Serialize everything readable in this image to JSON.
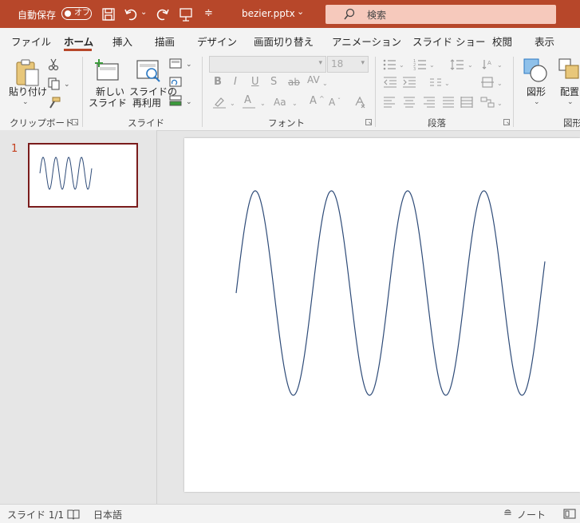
{
  "titlebar": {
    "autosave_label": "自動保存",
    "autosave_state": "オフ",
    "filename": "bezier.pptx",
    "filename_caret": "⌄",
    "search_placeholder": "検索",
    "bg_color": "#b7472a"
  },
  "tabs": [
    "ファイル",
    "ホーム",
    "挿入",
    "描画",
    "デザイン",
    "画面切り替え",
    "アニメーション",
    "スライド ショー",
    "校閲",
    "表示"
  ],
  "active_tab": "ホーム",
  "ribbon": {
    "clipboard": {
      "paste_label": "貼り付け",
      "group_label": "クリップボード"
    },
    "slides": {
      "new_slide_line1": "新しい",
      "new_slide_line2": "スライド",
      "reuse_line1": "スライドの",
      "reuse_line2": "再利用",
      "group_label": "スライド"
    },
    "font": {
      "font_name": "",
      "font_size": "18",
      "group_label": "フォント",
      "buttons": [
        "B",
        "I",
        "U",
        "S",
        "ab",
        "AV",
        "A",
        "Aa",
        "A",
        "A"
      ]
    },
    "paragraph": {
      "group_label": "段落"
    },
    "drawing": {
      "shapes_label": "図形",
      "arrange_label": "配置",
      "group_label": "図形"
    }
  },
  "thumbnail": {
    "slide_number": "1"
  },
  "status": {
    "slide_info": "スライド 1/1",
    "language": "日本語",
    "notes_label": "ノート"
  },
  "colors": {
    "accent": "#b7472a",
    "curve": "#2e4b78",
    "thumb_border": "#7a1c1c"
  }
}
